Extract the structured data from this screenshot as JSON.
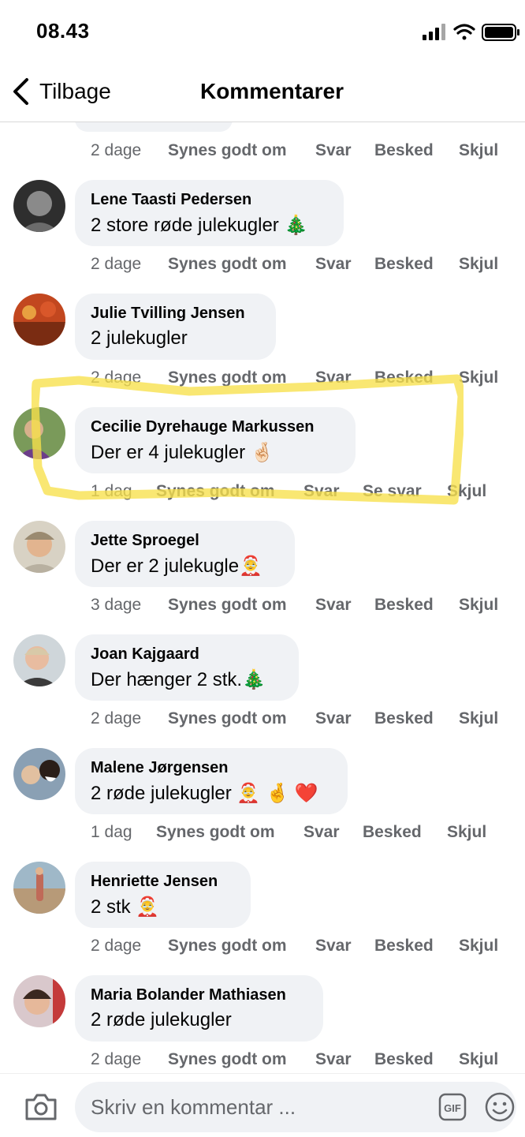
{
  "status_bar": {
    "time": "08.43"
  },
  "nav": {
    "back_label": "Tilbage",
    "title": "Kommentarer"
  },
  "actions": {
    "like": "Synes godt om",
    "reply": "Svar",
    "message": "Besked",
    "hide": "Skjul",
    "see_replies": "Se svar"
  },
  "first_action_row": {
    "time": "2 dage"
  },
  "comments": [
    {
      "author": "Lene Taasti Pedersen",
      "text": "2 store røde julekugler 🎄",
      "time": "2 dage"
    },
    {
      "author": "Julie Tvilling Jensen",
      "text": "2 julekugler",
      "time": "2 dage"
    },
    {
      "author": "Cecilie Dyrehauge Markussen",
      "text": "Der er 4 julekugler 🤞🏻",
      "time": "1 dag"
    },
    {
      "author": "Jette Sproegel",
      "text": "Der er 2 julekugle🤶",
      "time": "3 dage"
    },
    {
      "author": "Joan Kajgaard",
      "text": "Der hænger 2 stk.🎄",
      "time": "2 dage"
    },
    {
      "author": "Malene Jørgensen",
      "text": "2 røde julekugler 🤶 🤞 ❤️",
      "time": "1 dag"
    },
    {
      "author": "Henriette Jensen",
      "text": "2 stk 🤶",
      "time": "2 dage"
    },
    {
      "author": "Maria Bolander Mathiasen",
      "text": "2 røde julekugler",
      "time": "2 dage"
    }
  ],
  "composer": {
    "placeholder": "Skriv en kommentar ...",
    "gif_label": "GIF"
  },
  "colors": {
    "meta": "#65676b",
    "bubble": "#f0f2f5",
    "highlight": "#f7e04a"
  },
  "icons": [
    "back-chevron-icon",
    "signal-icon",
    "wifi-icon",
    "battery-icon",
    "camera-icon",
    "gif-icon",
    "emoji-icon"
  ]
}
